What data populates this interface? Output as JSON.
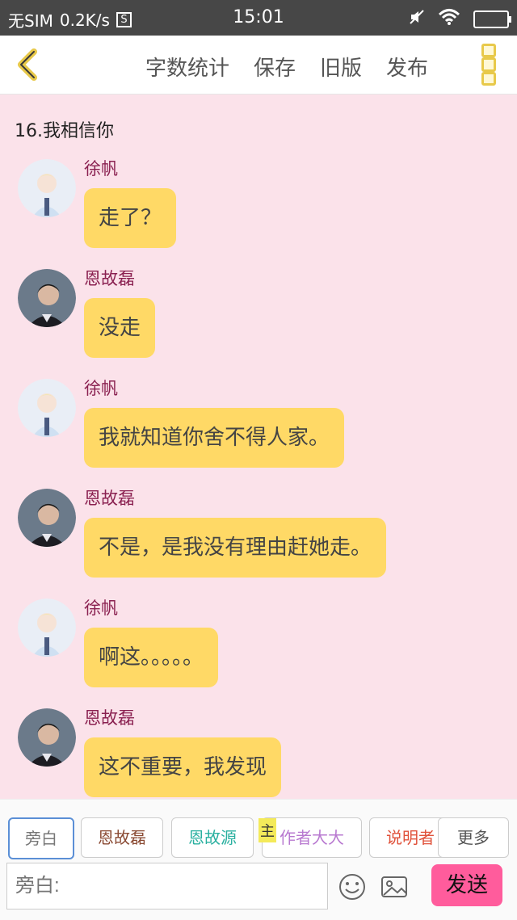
{
  "status_bar": {
    "carrier": "无SIM",
    "speed": "0.2K/s",
    "s_icon_text": "S",
    "time": "15:01"
  },
  "top_bar": {
    "word_count": "字数统计",
    "save": "保存",
    "old_version": "旧版",
    "publish": "发布"
  },
  "chapter_title": "16.我相信你",
  "messages": [
    {
      "name": "徐帆",
      "text": "走了？"
    },
    {
      "name": "恩故磊",
      "text": "没走"
    },
    {
      "name": "徐帆",
      "text": "我就知道你舍不得人家。"
    },
    {
      "name": "恩故磊",
      "text": "不是，是我没有理由赶她走。"
    },
    {
      "name": "徐帆",
      "text": "啊这。。。。。"
    },
    {
      "name": "恩故磊",
      "text": "这不重要，我发现"
    }
  ],
  "roles": [
    {
      "label": "旁白",
      "color": "#777777"
    },
    {
      "label": "恩故磊",
      "color": "#8a4a33"
    },
    {
      "label": "恩故源",
      "color": "#2ab0a0"
    },
    {
      "label": "作者大大",
      "color": "#b879d0"
    },
    {
      "label": "说明者",
      "color": "#e0523b"
    },
    {
      "label": "更多",
      "color": "#555555"
    }
  ],
  "main_tag": "主",
  "input_placeholder": "旁白:",
  "send_label": "发送",
  "colors": {
    "background": "#fbe2ea",
    "bubble": "#ffd966",
    "name": "#8a2050",
    "send": "#ff5c9c",
    "accent": "#e8c94a"
  }
}
